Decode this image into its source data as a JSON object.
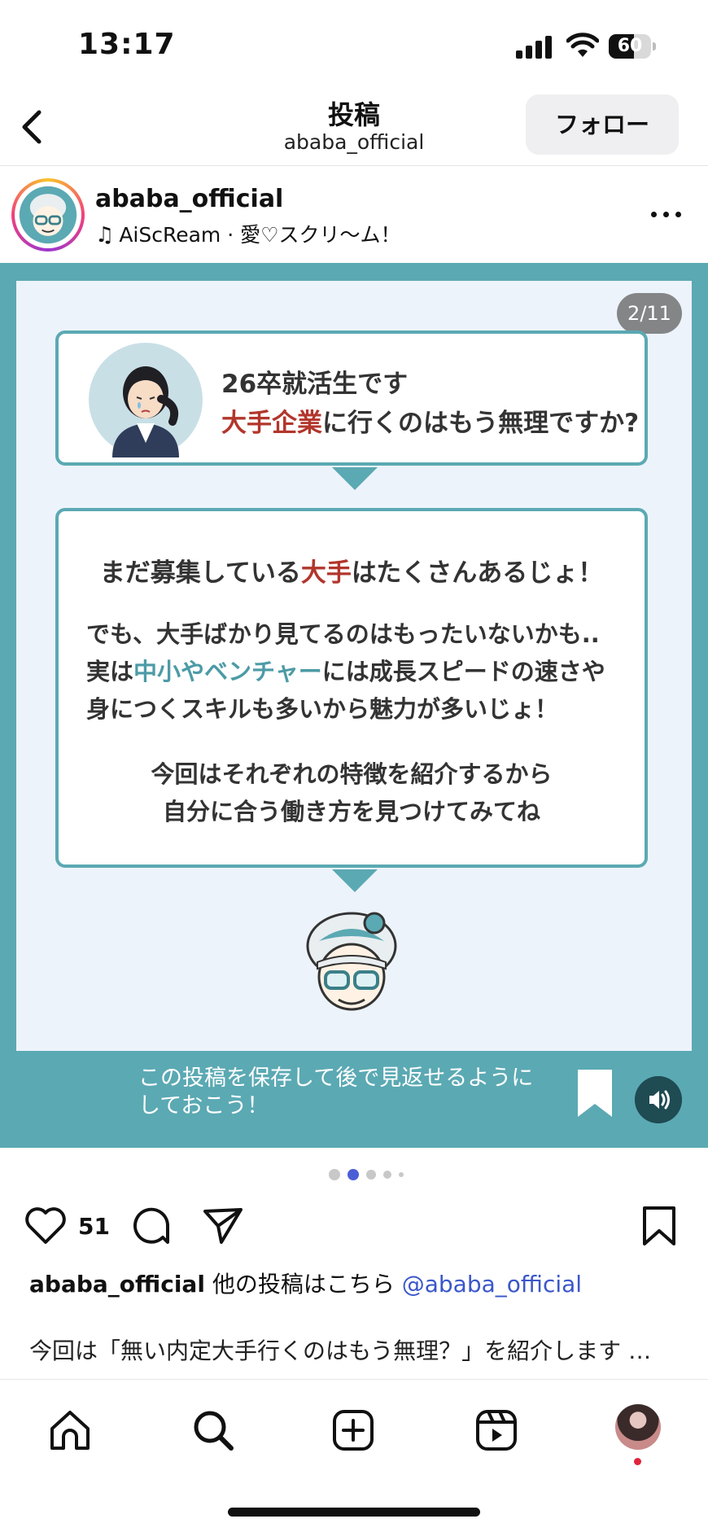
{
  "status_bar": {
    "time": "13:17",
    "battery": "60",
    "battery_level": 0.6
  },
  "header": {
    "title": "投稿",
    "subtitle": "ababa_official",
    "follow_label": "フォロー"
  },
  "post": {
    "username": "ababa_official",
    "music": "AiScReam · 愛♡スクリ〜ム！"
  },
  "slide": {
    "page_counter": "2/11",
    "question_line1": "26卒就活生です",
    "question_line2_highlight": "大手企業",
    "question_line2_rest": "に行くのはもう無理ですか?",
    "answer_head_pre": "まだ募集している",
    "answer_head_highlight": "大手",
    "answer_head_post": "はたくさんあるじょ！",
    "answer_body_line1": "でも、大手ばかり見てるのはもったいないかも..",
    "answer_body_line2_pre": "実は",
    "answer_body_line2_highlight": "中小やベンチャー",
    "answer_body_line2_post": "には成長スピードの速さや",
    "answer_body_line3": "身につくスキルも多いから魅力が多いじょ！",
    "answer_foot_line1": "今回はそれぞれの特徴を紹介するから",
    "answer_foot_line2": "自分に合う働き方を見つけてみてね",
    "save_banner_line1": "この投稿を保存して後で見返せるように",
    "save_banner_line2": "しておこう！"
  },
  "carousel_dots": {
    "total": 5,
    "active_index": 1
  },
  "actions": {
    "like_count": "51"
  },
  "caption": {
    "username": "ababa_official",
    "text": "他の投稿はこちら",
    "mention": "@ababa_official",
    "line2": "今回は「無い内定大手行くのはもう無理？」を紹介します …"
  },
  "colors": {
    "teal": "#5ba9b3",
    "highlight_red": "#b2362b",
    "highlight_teal": "#4c9ba6",
    "mention_blue": "#3a57c9",
    "active_dot": "#4a5fd6"
  },
  "icons": [
    "back-icon",
    "more-icon",
    "heart-icon",
    "comment-icon",
    "share-icon",
    "bookmark-icon",
    "home-icon",
    "search-icon",
    "create-icon",
    "reels-icon",
    "sound-icon"
  ]
}
